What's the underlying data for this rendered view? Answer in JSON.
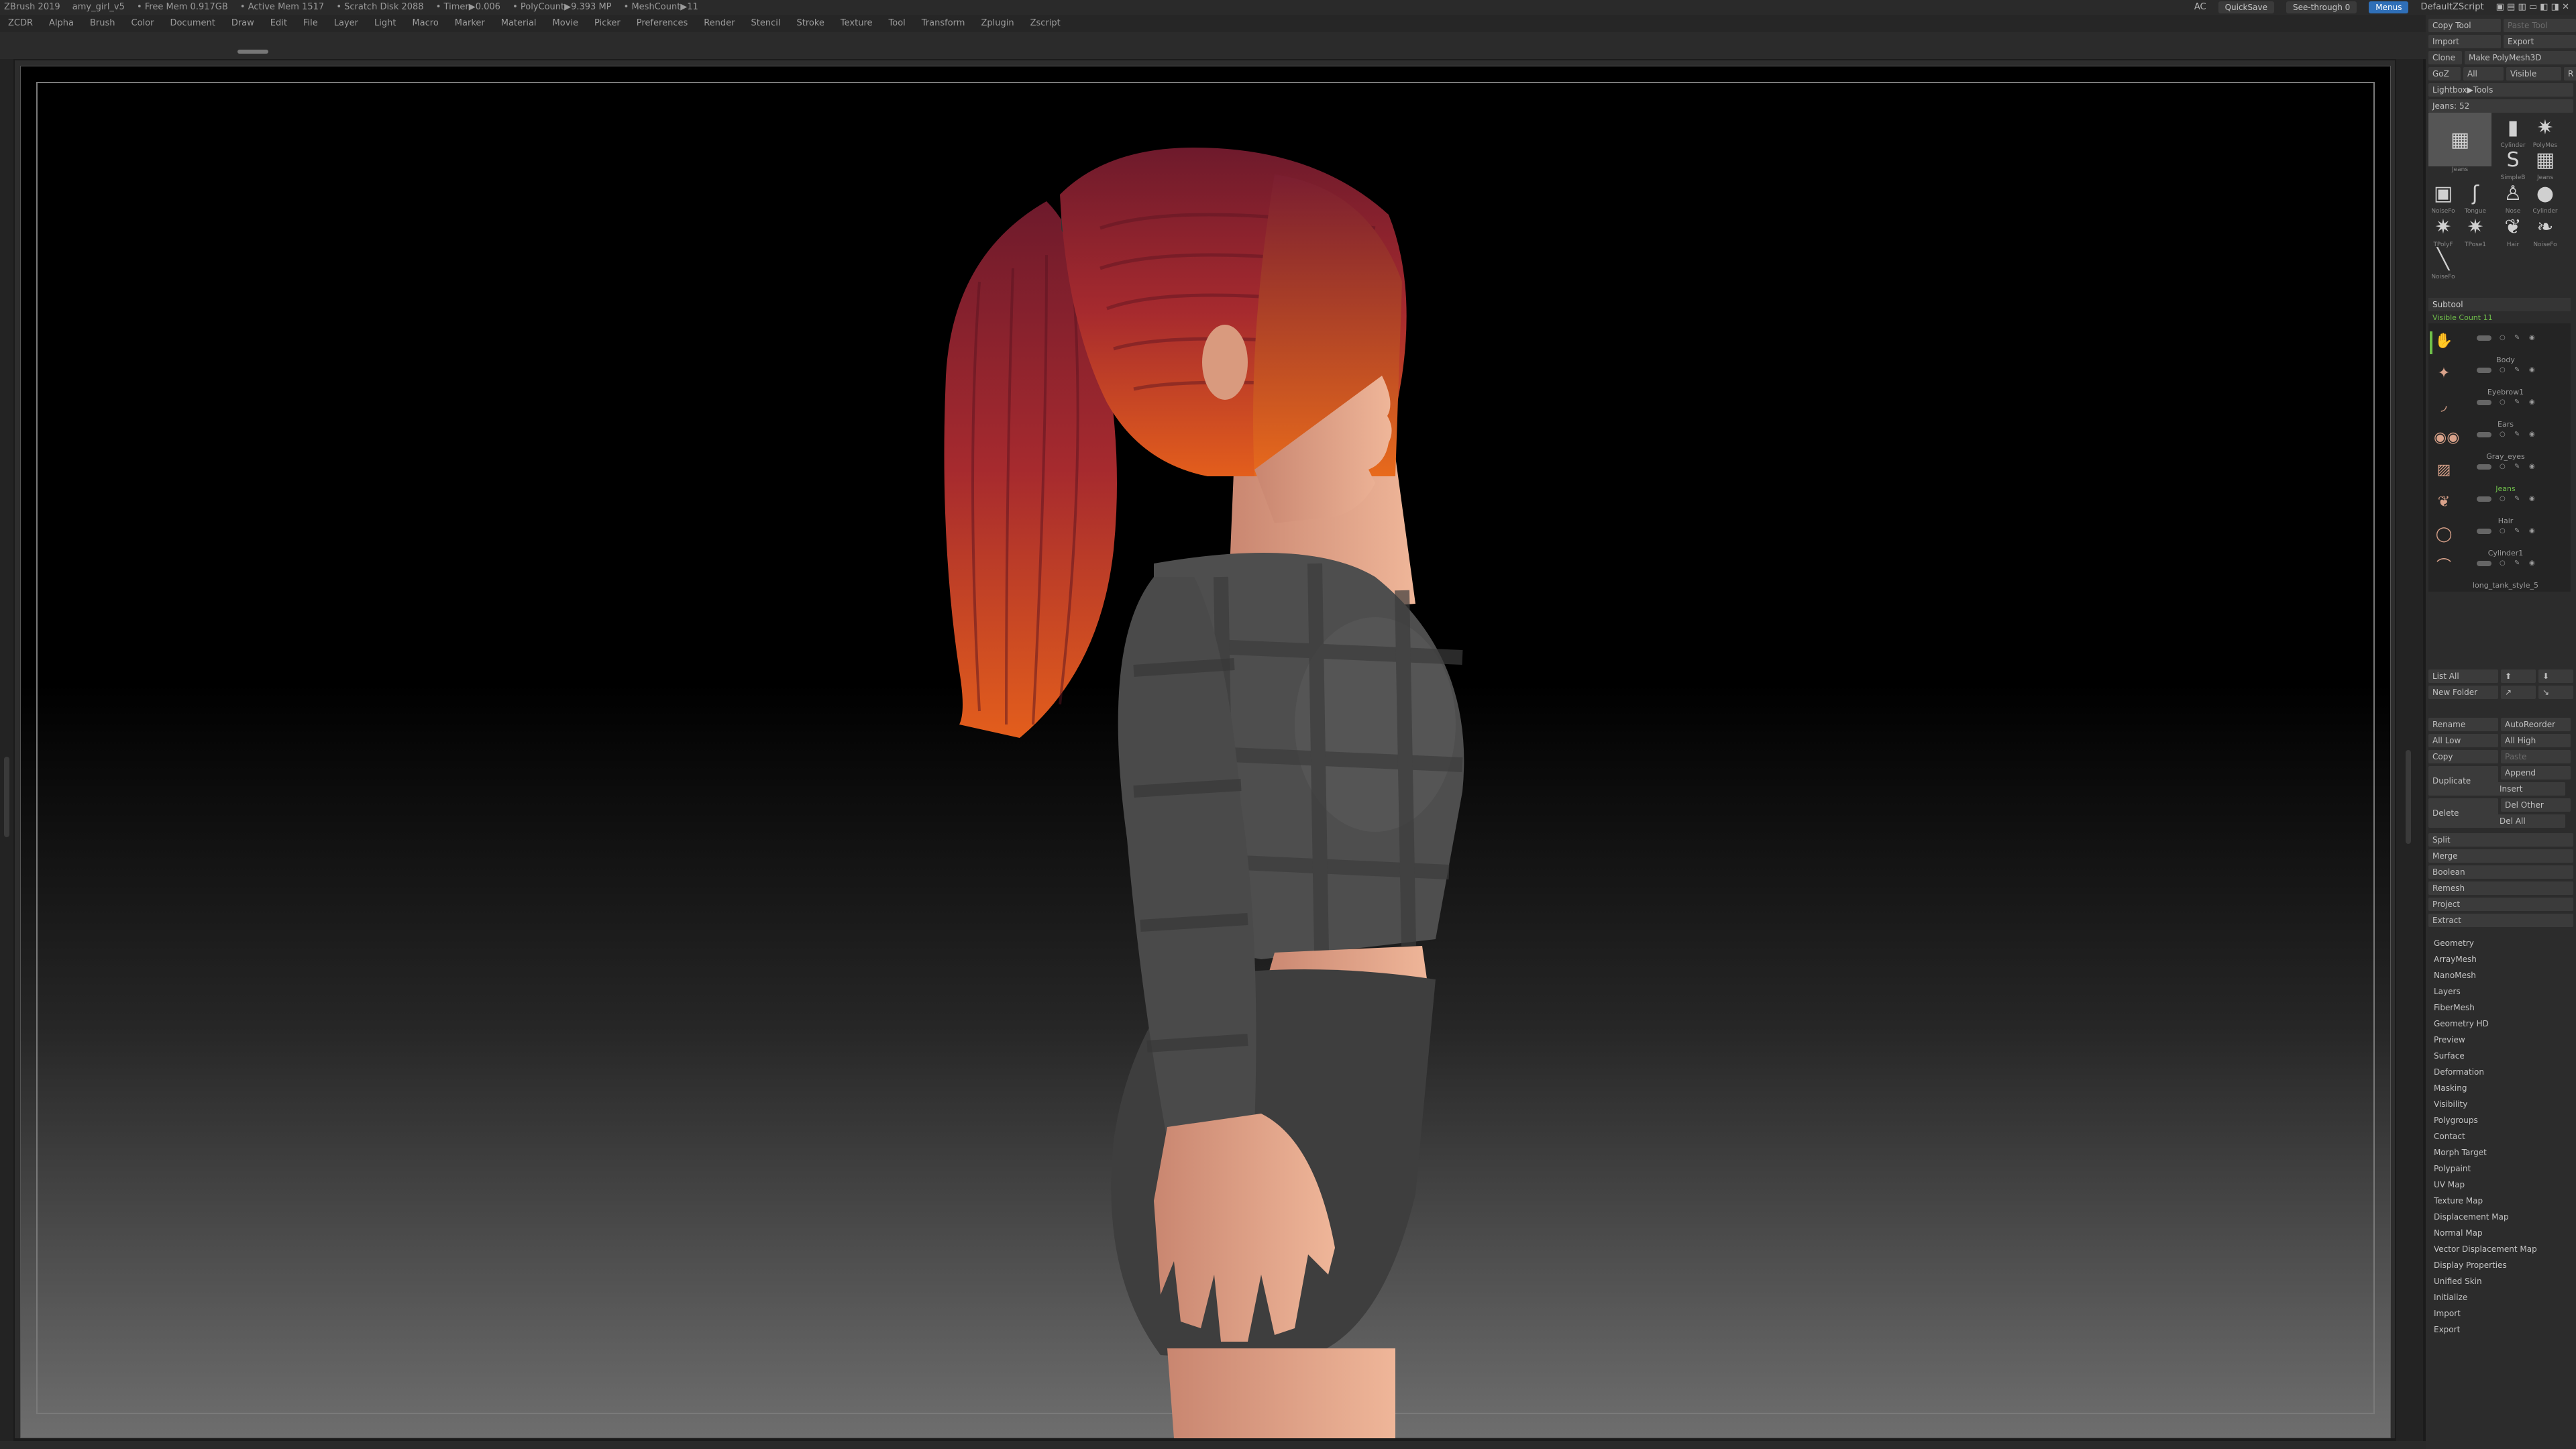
{
  "titlebar": {
    "app": "ZBrush 2019",
    "file": "amy_girl_v5",
    "free_mem": "• Free Mem 0.917GB",
    "active_mem": "• Active Mem 1517",
    "scratch": "• Scratch Disk 2088",
    "timer": "• Timer▶0.006",
    "polycount": "• PolyCount▶9.393 MP",
    "meshcount": "• MeshCount▶11",
    "ac": "AC",
    "quicksave": "QuickSave",
    "see_through": "See-through  0",
    "menus_btn": "Menus",
    "default_zscript": "DefaultZScript"
  },
  "menubar": [
    "ZCDR",
    "Alpha",
    "Brush",
    "Color",
    "Document",
    "Draw",
    "Edit",
    "File",
    "Layer",
    "Light",
    "Macro",
    "Marker",
    "Material",
    "Movie",
    "Picker",
    "Preferences",
    "Render",
    "Stencil",
    "Stroke",
    "Texture",
    "Tool",
    "Transform",
    "Zplugin",
    "Zscript"
  ],
  "tool_panel": {
    "copy_tool": "Copy Tool",
    "paste_tool": "Paste Tool",
    "import": "Import",
    "export": "Export",
    "clone": "Clone",
    "make_polymesh": "Make PolyMesh3D",
    "goz": "GoZ",
    "all": "All",
    "visible": "Visible",
    "r": "R",
    "lightbox_tools": "Lightbox▶Tools",
    "current_tool": "Jeans: 52",
    "thumbs": [
      {
        "label": "Jeans",
        "icon": "▦"
      },
      {
        "label": "Cylinder",
        "icon": "▮"
      },
      {
        "label": "PolyMes",
        "icon": "✷"
      },
      {
        "label": "SimpleB",
        "icon": "S"
      },
      {
        "label": "Jeans",
        "icon": "▦"
      },
      {
        "label": "NoiseFo",
        "icon": "▣"
      },
      {
        "label": "Tongue",
        "icon": "ʃ"
      },
      {
        "label": "Nose",
        "icon": "♙"
      },
      {
        "label": "Cylinder",
        "icon": "●"
      },
      {
        "label": "TPolyF",
        "icon": "✷"
      },
      {
        "label": "TPose1",
        "icon": "✷"
      },
      {
        "label": "Hair",
        "icon": "❦"
      },
      {
        "label": "NoiseFo",
        "icon": "❧"
      },
      {
        "label": "NoiseFo",
        "icon": "╲"
      }
    ]
  },
  "subtool": {
    "header": "Subtool",
    "visible_count": "Visible Count 11",
    "items": [
      {
        "name": "",
        "icon": "✋"
      },
      {
        "name": "Body",
        "icon": "✦"
      },
      {
        "name": "Eyebrow1",
        "icon": "◞"
      },
      {
        "name": "Ears",
        "icon": "◉◉"
      },
      {
        "name": "Gray_eyes",
        "icon": "▨"
      },
      {
        "name": "Jeans",
        "icon": "❦"
      },
      {
        "name": "Hair",
        "icon": "◯"
      },
      {
        "name": "Cylinder1",
        "icon": "⌒"
      }
    ],
    "last_item": "long_tank_style_5"
  },
  "commands": {
    "list_all": "List All",
    "new_folder": "New Folder",
    "rename": "Rename",
    "auto_reorder": "AutoReorder",
    "all_low": "All Low",
    "all_high": "All High",
    "copy": "Copy",
    "paste": "Paste",
    "append": "Append",
    "duplicate": "Duplicate",
    "insert": "Insert",
    "delete": "Delete",
    "del_other": "Del Other",
    "del_all": "Del All",
    "split": "Split",
    "merge": "Merge",
    "boolean": "Boolean",
    "remesh": "Remesh",
    "project": "Project",
    "extract": "Extract"
  },
  "sections": [
    "Geometry",
    "ArrayMesh",
    "NanoMesh",
    "Layers",
    "FiberMesh",
    "Geometry HD",
    "Preview",
    "Surface",
    "Deformation",
    "Masking",
    "Visibility",
    "Polygroups",
    "Contact",
    "Morph Target",
    "Polypaint",
    "UV Map",
    "Texture Map",
    "Displacement Map",
    "Normal Map",
    "Vector Displacement Map",
    "Display Properties",
    "Unified Skin",
    "Initialize",
    "Import",
    "Export"
  ],
  "colors": {
    "accent_green": "#6fbf4a",
    "accent_blue": "#2f6fb8",
    "hair_top": "#7a1a2a",
    "hair_bottom": "#e0581e",
    "skin": "#e0a58a",
    "shirt": "#4e4e4e",
    "shorts": "#3e3e3e"
  }
}
